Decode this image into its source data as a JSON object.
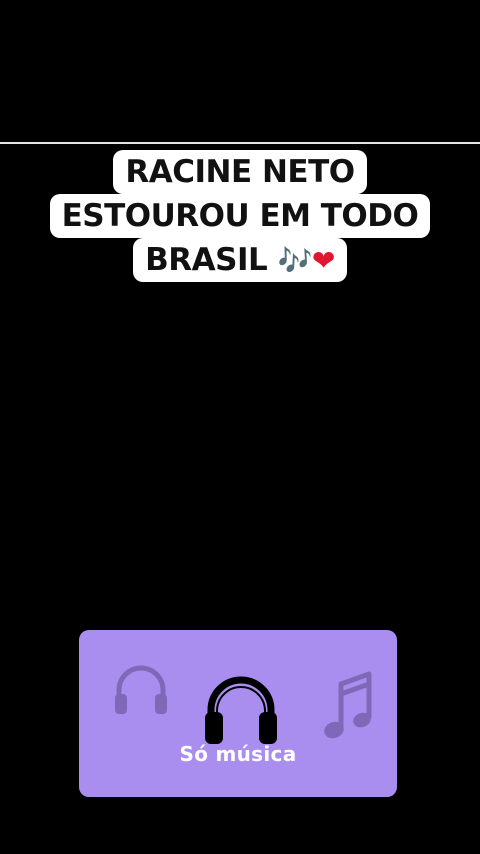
{
  "caption": {
    "lines": [
      "RACINE NETO",
      "ESTOUROU EM TODO",
      "BRASIL"
    ],
    "emoji_notes": "🎶",
    "emoji_heart": "❤"
  },
  "card": {
    "label": "Só música",
    "background_color": "#a98ef0",
    "icons": [
      "headphones-icon",
      "headphones-icon",
      "music-note-icon"
    ]
  }
}
